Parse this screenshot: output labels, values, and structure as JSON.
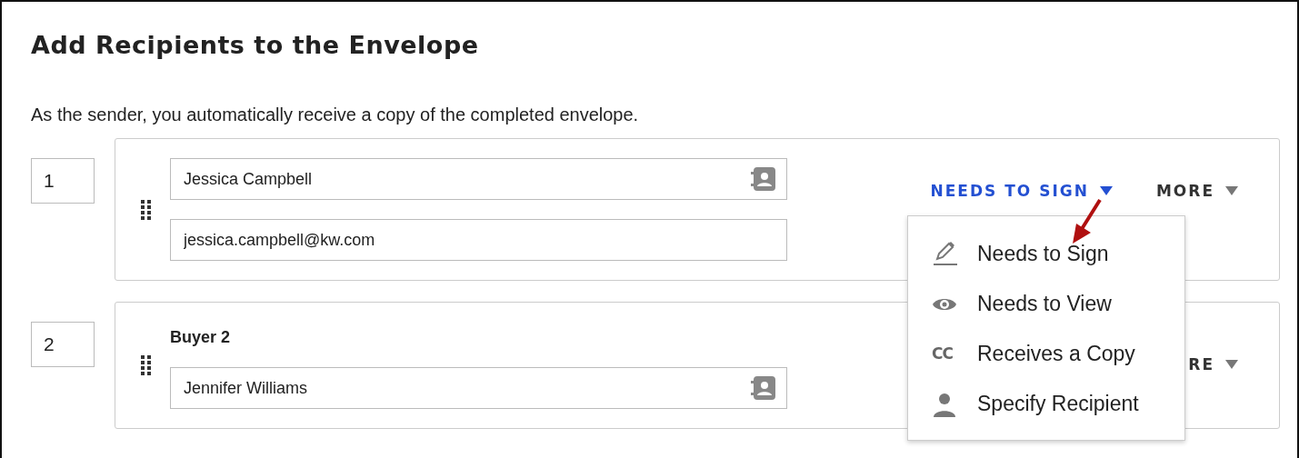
{
  "title": "Add Recipients to the Envelope",
  "subtitle": "As the sender, you automatically receive a copy of the completed envelope.",
  "recipients": [
    {
      "order": "1",
      "name": "Jessica Campbell",
      "email": "jessica.campbell@kw.com",
      "role_label": "NEEDS TO SIGN",
      "more_label": "MORE"
    },
    {
      "order": "2",
      "label": "Buyer 2",
      "name": "Jennifer Williams",
      "more_label": "RE"
    }
  ],
  "role_menu": {
    "items": [
      {
        "kind": "sign",
        "label": "Needs to Sign"
      },
      {
        "kind": "view",
        "label": "Needs to View"
      },
      {
        "kind": "copy",
        "icon_text": "CC",
        "label": "Receives a Copy"
      },
      {
        "kind": "specify",
        "label": "Specify Recipient"
      }
    ]
  }
}
